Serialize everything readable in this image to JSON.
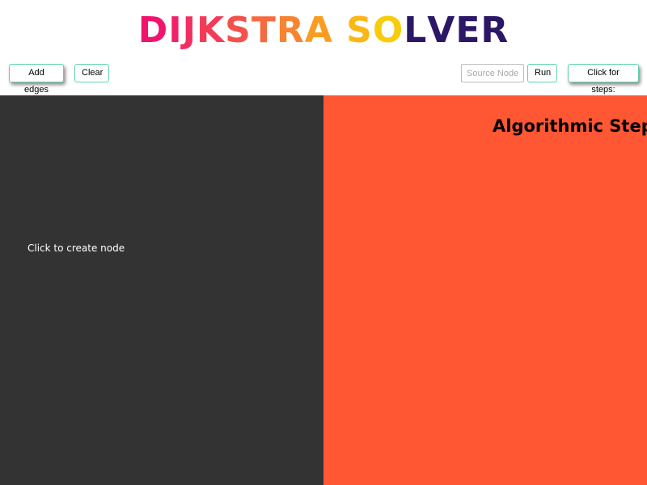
{
  "app": {
    "title_parts": [
      {
        "text": "D",
        "color": "#f0146f"
      },
      {
        "text": "I",
        "color": "#f1216a"
      },
      {
        "text": "J",
        "color": "#f22e62"
      },
      {
        "text": "K",
        "color": "#f33b58"
      },
      {
        "text": "S",
        "color": "#f4514c"
      },
      {
        "text": "T",
        "color": "#f56a3e"
      },
      {
        "text": "R",
        "color": "#f78430"
      },
      {
        "text": "A",
        "color": "#f99d22"
      },
      {
        "text": " ",
        "color": "#ffffff"
      },
      {
        "text": "S",
        "color": "#fbb716"
      },
      {
        "text": "O",
        "color": "#f8cc0b"
      },
      {
        "text": "L",
        "color": "#2b1766"
      },
      {
        "text": "V",
        "color": "#2b1766"
      },
      {
        "text": "E",
        "color": "#2b1766"
      },
      {
        "text": "R",
        "color": "#2b1766"
      }
    ]
  },
  "toolbar": {
    "add_edges_label": "Add edges",
    "clear_label": "Clear",
    "source_node_placeholder": "Source Node",
    "source_node_value": "",
    "run_label": "Run",
    "steps_label": "Click for steps:"
  },
  "canvas": {
    "hint": "Click to create node",
    "background": "#333333"
  },
  "steps_panel": {
    "heading": "Algorithmic Steps",
    "background": "#ff5733"
  },
  "colors": {
    "button_border": "#5fd3a8"
  }
}
